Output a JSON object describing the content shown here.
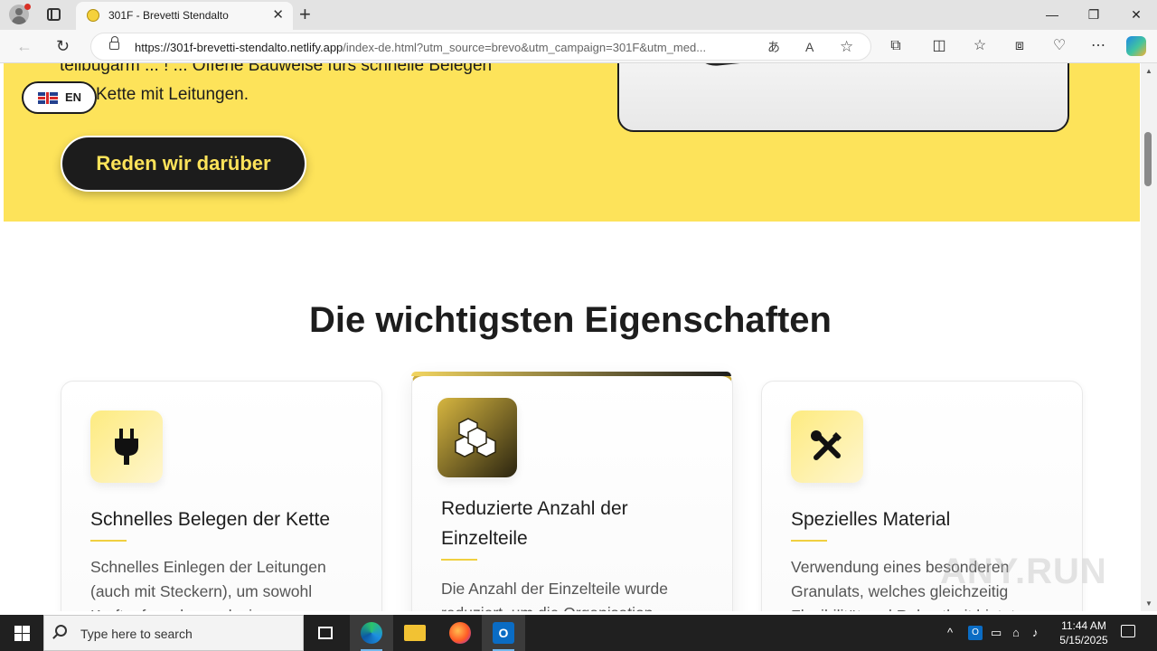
{
  "browser": {
    "tab_title": "301F - Brevetti Stendalto",
    "url_host": "https://301f-brevetti-stendalto.netlify.app",
    "url_rest": "/index-de.html?utm_source=brevo&utm_campaign=301F&utm_med..."
  },
  "page": {
    "hero_line1": "teilbügarm ... ! ... Offene Bauweise fürs schnelle Belegen",
    "hero_line2": "Kette mit Leitungen.",
    "cta_label": "Reden wir darüber",
    "lang_label": "EN",
    "section_title": "Die wichtigsten Eigenschaften",
    "cards": [
      {
        "icon": "plug-icon",
        "title": "Schnelles Belegen der Kette",
        "text1": "Schnelles Einlegen der Leitungen",
        "text2": "(auch mit Steckern), um sowohl",
        "text3": "Kraftaufwand zu reduzieren"
      },
      {
        "icon": "cubes-icon",
        "title1": "Reduzierte Anzahl der",
        "title2": "Einzelteile",
        "text1": "Die Anzahl der Einzelteile wurde",
        "text2": "reduziert, um die Organisation"
      },
      {
        "icon": "tools-icon",
        "title": "Spezielles Material",
        "text1": "Verwendung eines besonderen",
        "text2": "Granulats, welches gleichzeitig",
        "text3": "Flexibilität und Robustheit bietet"
      }
    ],
    "watermark": "ANY.RUN"
  },
  "taskbar": {
    "search_placeholder": "Type here to search",
    "time": "11:44 AM",
    "date": "5/15/2025"
  },
  "colors": {
    "accent_yellow": "#fde35a",
    "dark": "#1c1c1c"
  }
}
